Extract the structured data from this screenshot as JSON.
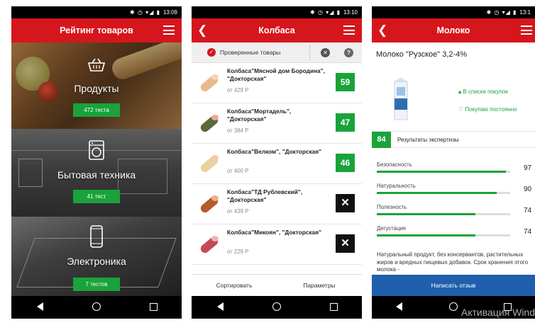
{
  "phone1": {
    "status_time": "13:09",
    "title": "Рейтинг товаров",
    "categories": [
      {
        "name": "Продукты",
        "badge": "472 теста",
        "icon": "basket-icon"
      },
      {
        "name": "Бытовая техника",
        "badge": "41 тест",
        "icon": "washing-machine-icon"
      },
      {
        "name": "Электроника",
        "badge": "7 тестов",
        "icon": "smartphone-icon"
      }
    ]
  },
  "phone2": {
    "status_time": "13:10",
    "title": "Колбаса",
    "filter_label": "Проверенные товары",
    "items": [
      {
        "name": "Колбаса\"Мясной дом Бородина\", \"Докторская\"",
        "price": "от 429 Р",
        "score": "59"
      },
      {
        "name": "Колбаса\"Мортадель\", \"Докторская\"",
        "price": "от 384 Р",
        "score": "47"
      },
      {
        "name": "Колбаса\"Велком\", \"Докторская\"",
        "price": "от 400 Р",
        "score": "46"
      },
      {
        "name": "Колбаса\"ТД Рублевский\", \"Докторская\"",
        "price": "от 439 Р",
        "score": "✕"
      },
      {
        "name": "Колбаса\"Микоян\", \"Докторская\"",
        "price": "от 229 Р",
        "score": "✕"
      }
    ],
    "sort_label": "Сортировать",
    "params_label": "Параметры"
  },
  "phone3": {
    "status_time": "13:1",
    "title": "Молоко",
    "product_title": "Молоко \"Рузское\" 3,2-4%",
    "action_list": "В списке покупок",
    "action_buy": "Покупаю постоянно",
    "expertise_score": "84",
    "expertise_label": "Результаты экспертизы",
    "metrics": [
      {
        "label": "Безопасность",
        "value": 97
      },
      {
        "label": "Натуральность",
        "value": 90
      },
      {
        "label": "Полезность",
        "value": 74
      },
      {
        "label": "Дегустация",
        "value": 74
      }
    ],
    "description": "Натуральный продукт, без консервантов, растительных жиров и вредных пищевых добавок. Срок хранения этого молока -",
    "review_button": "Написать отзыв",
    "watermark": "Активация Wind"
  },
  "colors": {
    "brand_red": "#d6161d",
    "score_green": "#1aa33a",
    "review_blue": "#1f5fae"
  }
}
